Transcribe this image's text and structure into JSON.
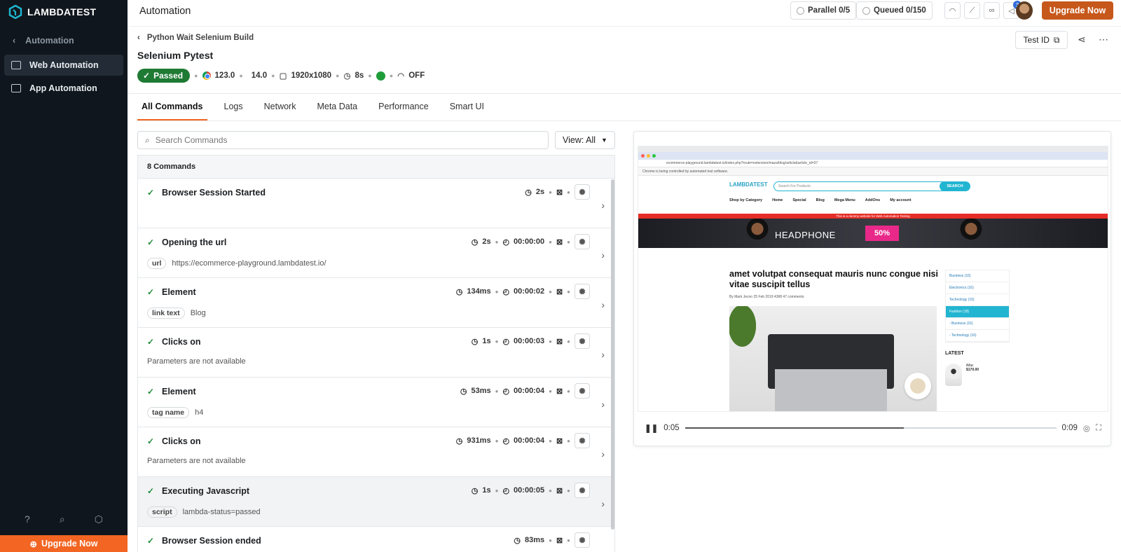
{
  "brand": {
    "name": "LAMBDATEST",
    "accent": "#f26522"
  },
  "sidebar": {
    "back_label": "Automation",
    "items": [
      {
        "label": "Web Automation",
        "active": true,
        "icon": "web-automation-icon"
      },
      {
        "label": "App Automation",
        "active": false,
        "icon": "app-automation-icon"
      }
    ],
    "bottom_icons": [
      "help-icon",
      "search-icon",
      "settings-icon"
    ],
    "upgrade_label": "Upgrade Now"
  },
  "topbar": {
    "title": "Automation",
    "parallel": "Parallel 0/5",
    "queued": "Queued 0/150",
    "notification_count": "3",
    "upgrade_label": "Upgrade Now"
  },
  "header": {
    "breadcrumb": "Python Wait Selenium Build",
    "title": "Selenium Pytest",
    "status": "Passed",
    "browser_version": "123.0",
    "os_version": "14.0",
    "resolution": "1920x1080",
    "duration": "8s",
    "tunnel": "OFF",
    "test_id_label": "Test ID"
  },
  "tabs": [
    "All Commands",
    "Logs",
    "Network",
    "Meta Data",
    "Performance",
    "Smart UI"
  ],
  "search": {
    "placeholder": "Search Commands",
    "view_label": "View: All"
  },
  "commands": {
    "count_label": "8 Commands",
    "rows": [
      {
        "title": "Browser Session Started",
        "duration": "2s",
        "timestamp": "",
        "param_tag": "",
        "param_value": ""
      },
      {
        "title": "Opening the url",
        "duration": "2s",
        "timestamp": "00:00:00",
        "param_tag": "url",
        "param_value": "https://ecommerce-playground.lambdatest.io/"
      },
      {
        "title": "Element",
        "duration": "134ms",
        "timestamp": "00:00:02",
        "param_tag": "link text",
        "param_value": "Blog"
      },
      {
        "title": "Clicks on",
        "duration": "1s",
        "timestamp": "00:00:03",
        "param_tag": "",
        "param_value": "Parameters are not available"
      },
      {
        "title": "Element",
        "duration": "53ms",
        "timestamp": "00:00:04",
        "param_tag": "tag name",
        "param_value": "h4"
      },
      {
        "title": "Clicks on",
        "duration": "931ms",
        "timestamp": "00:00:04",
        "param_tag": "",
        "param_value": "Parameters are not available"
      },
      {
        "title": "Executing Javascript",
        "duration": "1s",
        "timestamp": "00:00:05",
        "param_tag": "script",
        "param_value": "lambda-status=passed"
      },
      {
        "title": "Browser Session ended",
        "duration": "83ms",
        "timestamp": "",
        "param_tag": "",
        "param_value": ""
      }
    ]
  },
  "video": {
    "current_time": "0:05",
    "total_time": "0:09",
    "progress": 0.59,
    "screen": {
      "info_bar": "Chrome is being controlled by automated test software.",
      "url": "ecommerce-playground.lambdatest.io/index.php?route=extension/maza/blog/article&article_id=37",
      "site_logo": "LAMBDATEST",
      "search_placeholder": "Search For Products",
      "search_button": "SEARCH",
      "nav": [
        "Shop by Category",
        "Home",
        "Special",
        "Blog",
        "Mega Menu",
        "AddOns",
        "My account"
      ],
      "strip": "This is a dummy website for Web Automation Testing",
      "banner_text": "HEADPHONE",
      "banner_sale": "50%",
      "article_title": "amet volutpat consequat mauris nunc congue nisi vitae suscipit tellus",
      "article_meta": "By Mark Jecno  25 Feb 2019  4368  47 comments",
      "categories": [
        "Business (16)",
        "Electronics (16)",
        "Technology (16)",
        "Fashion (18)",
        "- Business (16)",
        "- Technology (16)"
      ],
      "latest_label": "LATEST",
      "latest_item_name": "iMac",
      "latest_item_price": "$170.00"
    }
  }
}
